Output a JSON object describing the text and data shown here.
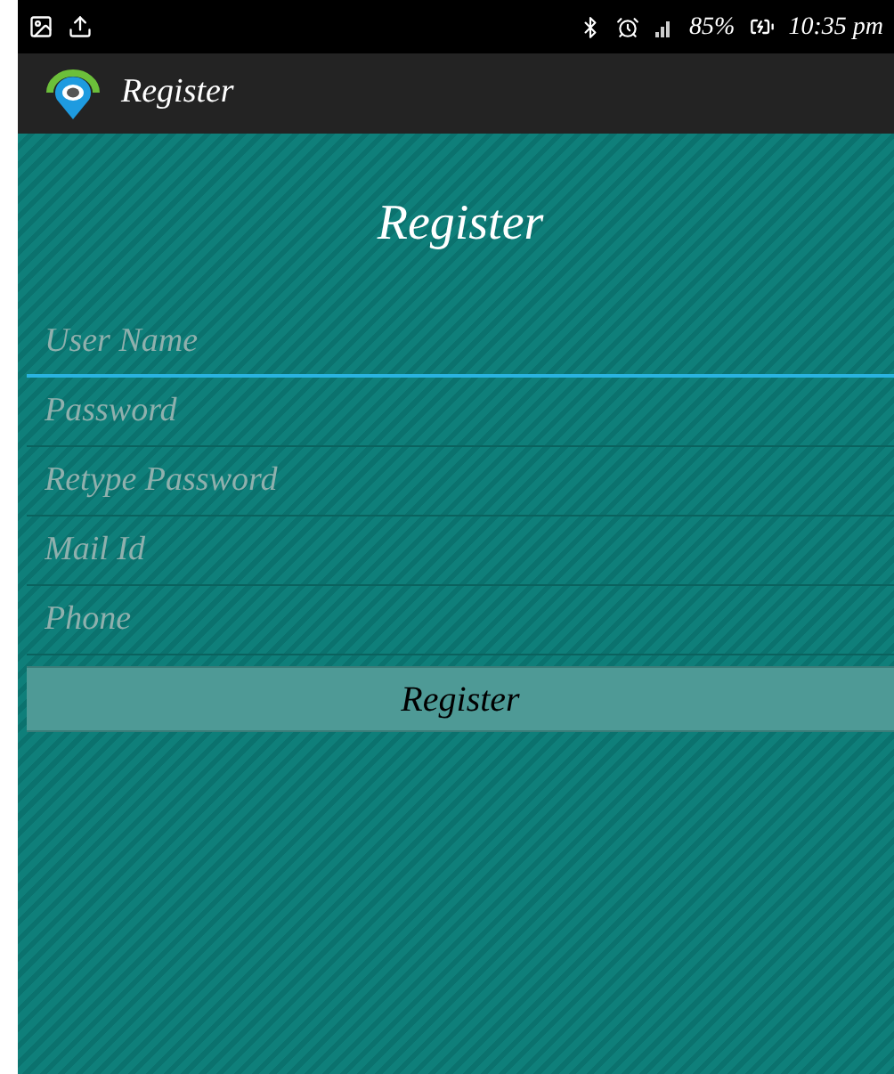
{
  "status_bar": {
    "battery_percent": "85%",
    "time": "10:35 pm"
  },
  "action_bar": {
    "title": "Register"
  },
  "form": {
    "heading": "Register",
    "fields": [
      {
        "placeholder": "User Name",
        "focused": true
      },
      {
        "placeholder": "Password",
        "focused": false
      },
      {
        "placeholder": "Retype Password",
        "focused": false
      },
      {
        "placeholder": "Mail Id",
        "focused": false
      },
      {
        "placeholder": "Phone",
        "focused": false
      }
    ],
    "submit": "Register"
  }
}
